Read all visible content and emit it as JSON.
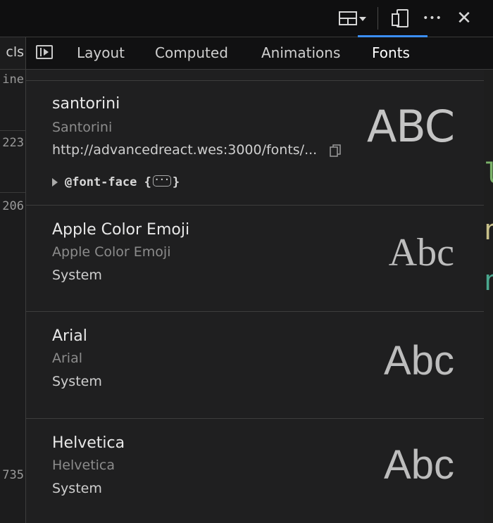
{
  "toolbar": {
    "icons": [
      "dock-layout-icon",
      "device-toggle-icon",
      "more-icon",
      "close-icon"
    ],
    "close_glyph": "✕",
    "more_glyph": "•••"
  },
  "left_column": {
    "header": "cls",
    "numbers": [
      "ine",
      "223",
      "206",
      "735"
    ]
  },
  "tabs": [
    {
      "label": "Layout",
      "active": false
    },
    {
      "label": "Computed",
      "active": false
    },
    {
      "label": "Animations",
      "active": false
    },
    {
      "label": "Fonts",
      "active": true
    }
  ],
  "fonts": [
    {
      "name": "santorini",
      "family": "Santorini",
      "source": "http://advancedreact.wes:3000/fonts/...",
      "preview": "ABC",
      "rule": "@font-face {",
      "rule_end": "}",
      "rule_badge": "···"
    },
    {
      "name": "Apple Color Emoji",
      "family": "Apple Color Emoji",
      "source": "System",
      "preview": "Abc"
    },
    {
      "name": "Arial",
      "family": "Arial",
      "source": "System",
      "preview": "Abc"
    },
    {
      "name": "Helvetica",
      "family": "Helvetica",
      "source": "System",
      "preview": "Abc"
    }
  ],
  "colors": {
    "accent": "#3b8ff7",
    "background": "#1f1f20",
    "edge_green": "#7bb36a",
    "edge_yellow": "#c8c08a",
    "edge_teal": "#4aa88f"
  }
}
